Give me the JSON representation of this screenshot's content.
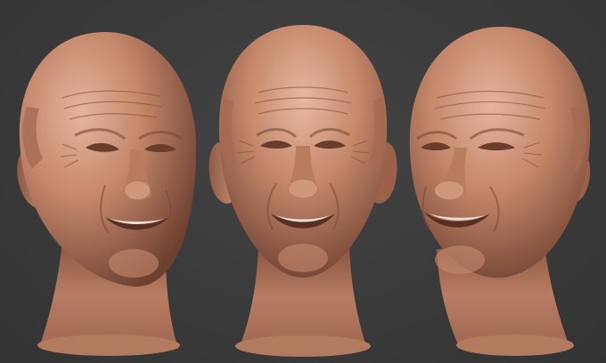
{
  "scene": {
    "background_color": "#3a3a3a",
    "skin_color": "#c08468",
    "skin_shadow_color": "#7a4a36",
    "skin_highlight_color": "#e4b39c",
    "teeth_color": "#eadbd2",
    "views": [
      {
        "name": "three-quarter-left"
      },
      {
        "name": "front"
      },
      {
        "name": "three-quarter-right"
      }
    ]
  }
}
